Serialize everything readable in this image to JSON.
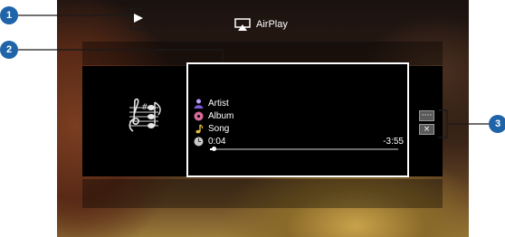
{
  "header": {
    "airplay_label": "AirPlay"
  },
  "track": {
    "artist": "Artist",
    "album": "Album",
    "song": "Song",
    "elapsed": "0:04",
    "remaining": "-3:55",
    "progress_fraction": 0.02
  },
  "controls": {
    "more_label": "····",
    "close_label": "×"
  },
  "callouts": [
    "1",
    "2",
    "3"
  ],
  "colors": {
    "callout": "#1f63a8",
    "panel_border": "#ffffff",
    "text": "#ffffff",
    "progress_track": "#6b6b6b"
  },
  "icons": {
    "status": "play-icon",
    "airplay": "airplay-icon",
    "cover": "music-notes-icon",
    "artist": "artist-icon",
    "album": "album-icon",
    "song": "song-note-icon",
    "time": "clock-icon"
  }
}
